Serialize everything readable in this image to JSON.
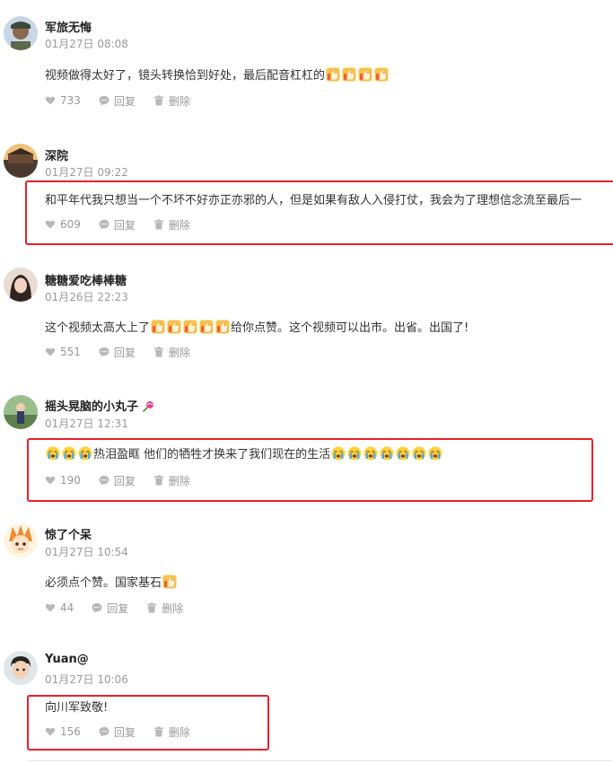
{
  "comments": [
    {
      "username": "军旅无悔",
      "time": "01月27日 08:08",
      "text": "视频做得太好了，镜头转换恰到好处，最后配音杠杠的",
      "text_after": "",
      "likes": "733",
      "reply_label": "回复",
      "delete_label": "删除",
      "trailing_emoji": "thumbs-up x4"
    },
    {
      "username": "深院",
      "time": "01月27日 09:22",
      "text": "和平年代我只想当一个不坏不好亦正亦邪的人，但是如果有敌人入侵打仗，我会为了理想信念流至最后一",
      "likes": "609",
      "reply_label": "回复",
      "delete_label": "删除"
    },
    {
      "username": "糖糖爱吃棒棒糖",
      "time": "01月26日 22:23",
      "text": "这个视频太高大上了",
      "text_after": "给你点赞。这个视频可以出市。出省。出国了!",
      "likes": "551",
      "reply_label": "回复",
      "delete_label": "删除",
      "inline_emoji": "thumbs-up x5"
    },
    {
      "username": "摇头晃脑的小丸子",
      "time": "01月27日 12:31",
      "text": "热泪盈眶 他们的牺牲才换来了我们现在的生活",
      "likes": "190",
      "reply_label": "回复",
      "delete_label": "删除",
      "leading_emoji": "crying-face x3",
      "trailing_emoji": "crying-face x7",
      "name_emoji": "lollipop-icon"
    },
    {
      "username": "惊了个呆",
      "time": "01月27日 10:54",
      "text": "必须点个赞。国家基石",
      "likes": "44",
      "reply_label": "回复",
      "delete_label": "删除",
      "trailing_emoji": "thumbs-up x1"
    },
    {
      "username": "Yuan@",
      "time": "01月27日 10:06",
      "text": "向川军致敬!",
      "likes": "156",
      "reply_label": "回复",
      "delete_label": "删除"
    }
  ],
  "colors": {
    "highlight_border": "#e8202a",
    "meta_text": "#9a9a9a",
    "action_text": "#999999"
  }
}
